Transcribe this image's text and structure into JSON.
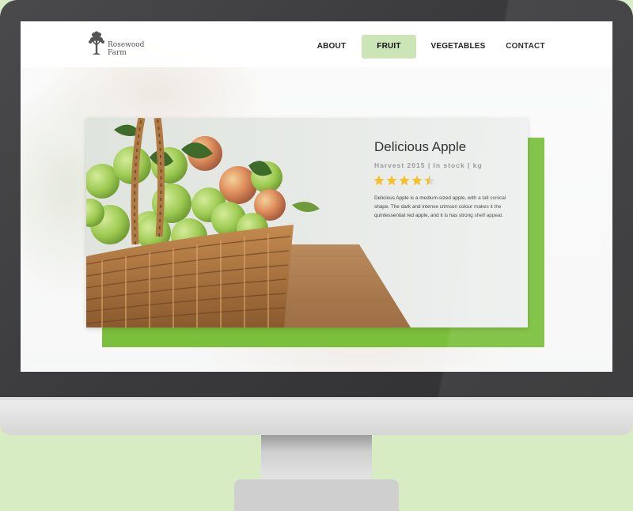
{
  "brand": {
    "logo_line1": "Rosewood",
    "logo_line2": "Farm",
    "logo_icon": "tree-icon"
  },
  "nav": {
    "items": [
      {
        "label": "ABOUT",
        "active": false
      },
      {
        "label": "FRUIT",
        "active": true
      },
      {
        "label": "VEGETABLES",
        "active": false
      },
      {
        "label": "CONTACT",
        "active": false
      }
    ]
  },
  "product": {
    "title": "Delicious Apple",
    "subtitle": "Harvest 2015 | In stock | kg",
    "rating": 4.5,
    "rating_max": 5,
    "description": "Delicious Apple is a medium-sized apple, with a tall conical shape. The dark and intense crimson colour makes it the quintessential red apple, and it is has strong shelf appeal.",
    "image": "basket-of-apples"
  },
  "colors": {
    "accent_green": "#7cbf3c",
    "nav_active_bg": "#cbe5b6",
    "star": "#f3c12e",
    "star_empty": "#d9d9d9"
  }
}
